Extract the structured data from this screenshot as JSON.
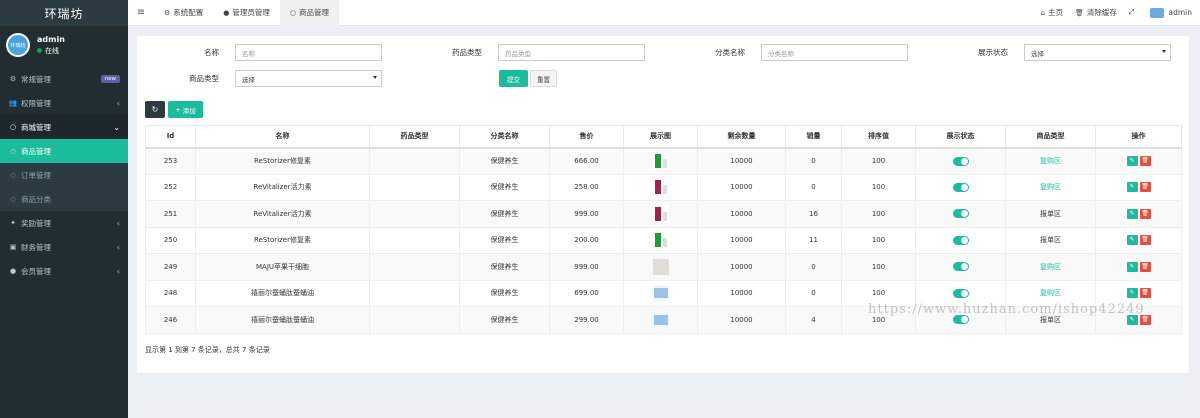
{
  "sidebar": {
    "brand": "环瑞坊",
    "user": {
      "name": "admin",
      "status": "在线",
      "avatar_text": "环瑞坊"
    },
    "menu": [
      {
        "label": "常规管理",
        "icon": "cogs-icon",
        "badge": "new"
      },
      {
        "label": "权限管理",
        "icon": "users-icon",
        "arrow": "‹"
      },
      {
        "label": "商城管理",
        "icon": "circle-icon",
        "arrow": "⌄"
      },
      {
        "label": "奖励管理",
        "icon": "gift-icon",
        "arrow": "‹"
      },
      {
        "label": "财务管理",
        "icon": "money-icon",
        "arrow": "‹"
      },
      {
        "label": "会员管理",
        "icon": "user-icon",
        "arrow": "‹"
      }
    ],
    "submenu": [
      {
        "label": "商品管理",
        "current": true
      },
      {
        "label": "订单管理"
      },
      {
        "label": "商品分类"
      }
    ]
  },
  "navbar": {
    "tabs": [
      {
        "label": "系统配置",
        "icon": "gear-icon"
      },
      {
        "label": "管理员管理",
        "icon": "user-icon"
      },
      {
        "label": "商品管理",
        "icon": "circle-icon",
        "active": true
      }
    ],
    "home": "主页",
    "clear_cache": "清除缓存",
    "admin": "admin"
  },
  "filters": {
    "name_label": "名称",
    "name_placeholder": "名称",
    "drug_type_label": "药品类型",
    "drug_type_placeholder": "药品类型",
    "category_label": "分类名称",
    "category_placeholder": "分类名称",
    "display_label": "展示状态",
    "display_value": "选择",
    "goods_type_label": "商品类型",
    "goods_type_value": "选择",
    "submit": "提交",
    "reset": "重置"
  },
  "toolbar": {
    "add": "添加"
  },
  "table": {
    "headers": [
      "Id",
      "名称",
      "药品类型",
      "分类名称",
      "售价",
      "展示图",
      "剩余数量",
      "销量",
      "排序值",
      "展示状态",
      "商品类型",
      "操作"
    ],
    "rows": [
      {
        "id": "253",
        "name": "ReStorizer修复素",
        "drug_type": "",
        "category": "保健养生",
        "price": "666.00",
        "img": "green",
        "stock": "10000",
        "sales": "0",
        "sort": "100",
        "type": "复购区",
        "type_link": true
      },
      {
        "id": "252",
        "name": "ReVitalizer活力素",
        "drug_type": "",
        "category": "保健养生",
        "price": "258.00",
        "img": "red",
        "stock": "10000",
        "sales": "0",
        "sort": "100",
        "type": "复购区",
        "type_link": true
      },
      {
        "id": "251",
        "name": "ReVitalizer活力素",
        "drug_type": "",
        "category": "保健养生",
        "price": "999.00",
        "img": "red",
        "stock": "10000",
        "sales": "16",
        "sort": "100",
        "type": "报单区",
        "type_link": false
      },
      {
        "id": "250",
        "name": "ReStorizer修复素",
        "drug_type": "",
        "category": "保健养生",
        "price": "200.00",
        "img": "green",
        "stock": "10000",
        "sales": "11",
        "sort": "100",
        "type": "报单区",
        "type_link": false
      },
      {
        "id": "249",
        "name": "MAJU苹果干细胞",
        "drug_type": "",
        "category": "保健养生",
        "price": "999.00",
        "img": "grey",
        "stock": "10000",
        "sales": "0",
        "sort": "100",
        "type": "复购区",
        "type_link": true
      },
      {
        "id": "248",
        "name": "禧丽尔蚕蛹肽蚕蛹油",
        "drug_type": "",
        "category": "保健养生",
        "price": "699.00",
        "img": "blue",
        "stock": "10000",
        "sales": "0",
        "sort": "100",
        "type": "复购区",
        "type_link": true
      },
      {
        "id": "246",
        "name": "禧丽尔蚕蛹肽蚕蛹油",
        "drug_type": "",
        "category": "保健养生",
        "price": "299.00",
        "img": "blue",
        "stock": "10000",
        "sales": "4",
        "sort": "100",
        "type": "报单区",
        "type_link": false
      }
    ]
  },
  "pager": {
    "info": "显示第 1 到第 7 条记录，总共 7 条记录"
  },
  "watermark": "https://www.huzhan.com/ishop42249",
  "colors": {
    "accent": "#1abc9c",
    "danger": "#e74c3c",
    "sidebar_bg": "#222d32"
  }
}
